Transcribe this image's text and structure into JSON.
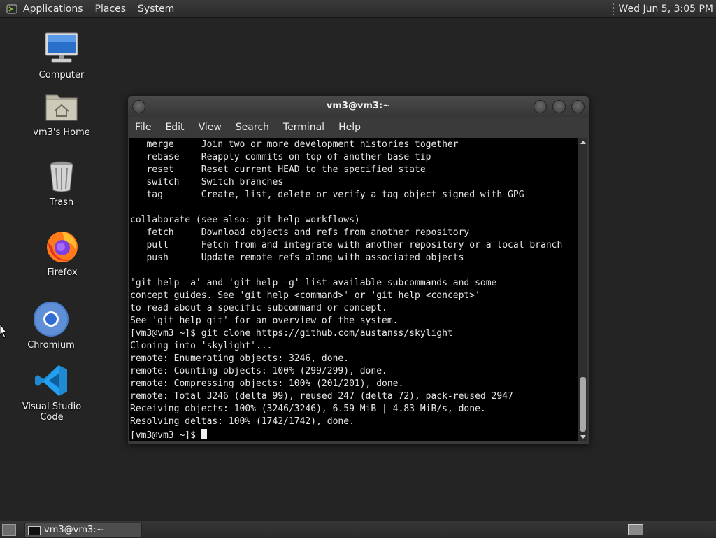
{
  "top_panel": {
    "menus": [
      "Applications",
      "Places",
      "System"
    ],
    "clock": "Wed Jun  5,  3:05 PM"
  },
  "desktop": {
    "icons": [
      {
        "label": "Computer",
        "icon": "computer-icon"
      },
      {
        "label": "vm3's Home",
        "icon": "home-folder-icon"
      },
      {
        "label": "Trash",
        "icon": "trash-icon"
      },
      {
        "label": "Firefox",
        "icon": "firefox-icon"
      },
      {
        "label": "Chromium",
        "icon": "chromium-icon"
      },
      {
        "label": "Visual Studio Code",
        "icon": "vscode-icon"
      }
    ]
  },
  "window": {
    "title": "vm3@vm3:~",
    "menus": [
      "File",
      "Edit",
      "View",
      "Search",
      "Terminal",
      "Help"
    ]
  },
  "terminal": {
    "lines": [
      "   merge     Join two or more development histories together",
      "   rebase    Reapply commits on top of another base tip",
      "   reset     Reset current HEAD to the specified state",
      "   switch    Switch branches",
      "   tag       Create, list, delete or verify a tag object signed with GPG",
      "",
      "collaborate (see also: git help workflows)",
      "   fetch     Download objects and refs from another repository",
      "   pull      Fetch from and integrate with another repository or a local branch",
      "   push      Update remote refs along with associated objects",
      "",
      "'git help -a' and 'git help -g' list available subcommands and some",
      "concept guides. See 'git help <command>' or 'git help <concept>'",
      "to read about a specific subcommand or concept.",
      "See 'git help git' for an overview of the system.",
      "[vm3@vm3 ~]$ git clone https://github.com/austanss/skylight",
      "Cloning into 'skylight'...",
      "remote: Enumerating objects: 3246, done.",
      "remote: Counting objects: 100% (299/299), done.",
      "remote: Compressing objects: 100% (201/201), done.",
      "remote: Total 3246 (delta 99), reused 247 (delta 72), pack-reused 2947",
      "Receiving objects: 100% (3246/3246), 6.59 MiB | 4.83 MiB/s, done.",
      "Resolving deltas: 100% (1742/1742), done."
    ],
    "prompt": "[vm3@vm3 ~]$ "
  },
  "taskbar": {
    "tasks": [
      {
        "label": "vm3@vm3:~"
      }
    ]
  },
  "colors": {
    "desktop_bg": "#242424",
    "terminal_bg": "#000000",
    "terminal_fg": "#e6e6e6"
  }
}
